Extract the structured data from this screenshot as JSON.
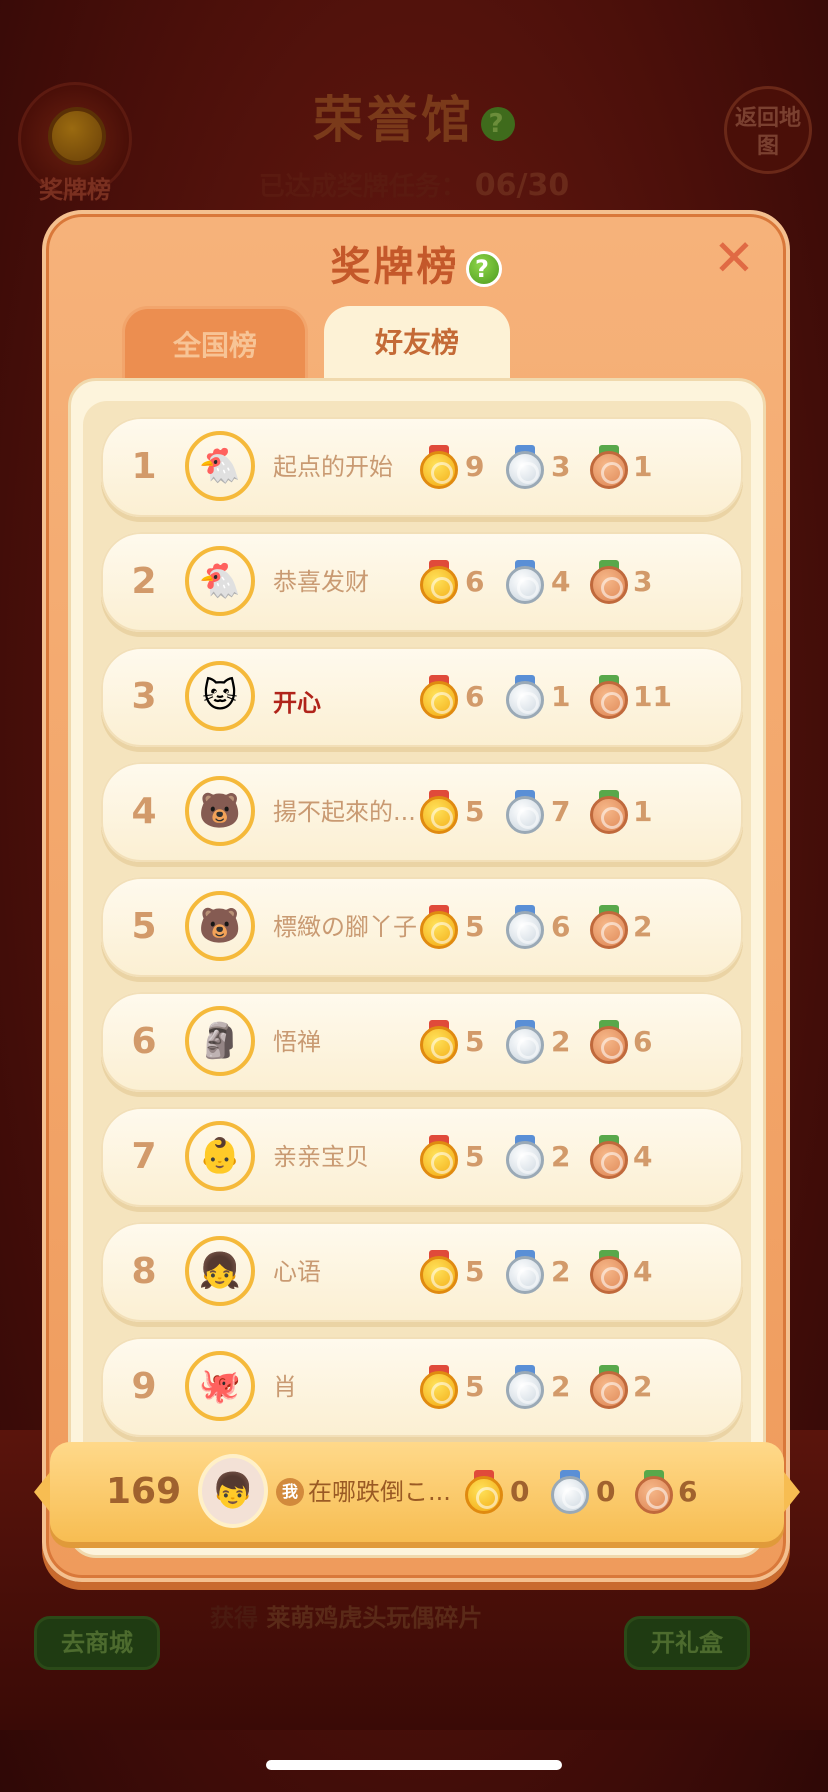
{
  "background": {
    "title": "荣誉馆",
    "progress_label": "已达成奖牌任务：",
    "progress_value": "06/30",
    "medal_board_label": "奖牌榜",
    "back_button_label": "返回地图",
    "reward_prefix": "获得",
    "reward_text": "莱萌鸡虎头玩偶碎片",
    "shop_button_label": "去商城",
    "gift_button_label": "开礼盒"
  },
  "modal": {
    "title": "奖牌榜",
    "tabs": [
      {
        "label": "全国榜",
        "active": false
      },
      {
        "label": "好友榜",
        "active": true
      }
    ]
  },
  "leaderboard": [
    {
      "rank": "1",
      "name": "起点的开始",
      "gold": "9",
      "silver": "3",
      "bronze": "1",
      "avatar_icon": "rooster-frame-icon"
    },
    {
      "rank": "2",
      "name": "恭喜发财",
      "gold": "6",
      "silver": "4",
      "bronze": "3",
      "avatar_icon": "rooster-frame-icon"
    },
    {
      "rank": "3",
      "name": "开心",
      "gold": "6",
      "silver": "1",
      "bronze": "11",
      "avatar_icon": "cat-frame-icon",
      "highlight": true
    },
    {
      "rank": "4",
      "name": "揚不起來的...",
      "gold": "5",
      "silver": "7",
      "bronze": "1",
      "avatar_icon": "bear-chick-icon"
    },
    {
      "rank": "5",
      "name": "標緻の腳丫子",
      "gold": "5",
      "silver": "6",
      "bronze": "2",
      "avatar_icon": "bear-deity-icon"
    },
    {
      "rank": "6",
      "name": "悟禅",
      "gold": "5",
      "silver": "2",
      "bronze": "6",
      "avatar_icon": "statue-photo-icon"
    },
    {
      "rank": "7",
      "name": "亲亲宝贝",
      "gold": "5",
      "silver": "2",
      "bronze": "4",
      "avatar_icon": "baby-photo-icon"
    },
    {
      "rank": "8",
      "name": "心语",
      "gold": "5",
      "silver": "2",
      "bronze": "4",
      "avatar_icon": "flower-girl-photo-icon"
    },
    {
      "rank": "9",
      "name": "肖",
      "gold": "5",
      "silver": "2",
      "bronze": "2",
      "avatar_icon": "purple-creature-icon"
    }
  ],
  "my_entry": {
    "rank": "169",
    "me_badge": "我",
    "name": "在哪跌倒こ...",
    "gold": "0",
    "silver": "0",
    "bronze": "6",
    "avatar_icon": "user-photo-icon"
  }
}
